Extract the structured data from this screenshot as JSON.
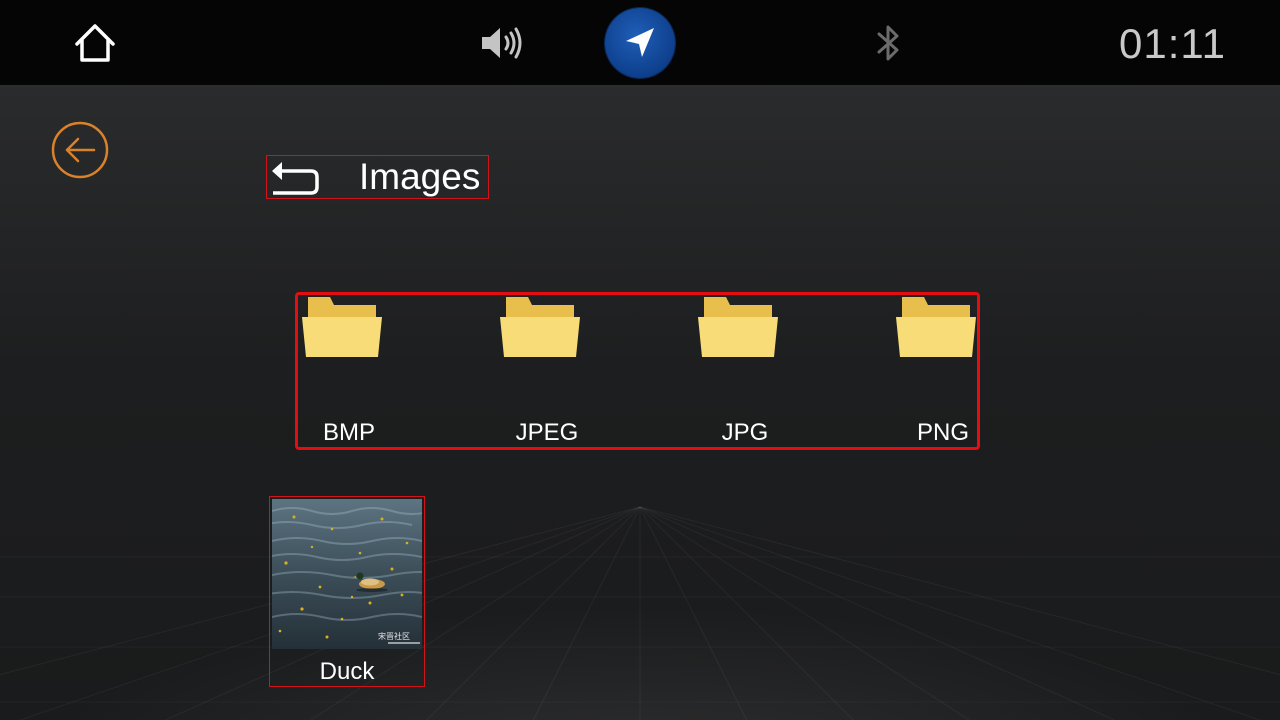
{
  "status_bar": {
    "clock": "01:11",
    "icons": [
      "home-icon",
      "volume-icon",
      "navigation-icon",
      "bluetooth-icon"
    ],
    "nav_button_color": "#0e3f8c"
  },
  "browser": {
    "title": "Images",
    "folders": [
      {
        "label": "BMP"
      },
      {
        "label": "JPEG"
      },
      {
        "label": "JPG"
      },
      {
        "label": "PNG"
      }
    ],
    "files": [
      {
        "label": "Duck",
        "watermark": "宋晋社区"
      }
    ]
  },
  "colors": {
    "back_accent": "#d9822b",
    "highlight_border": "#e30d12",
    "folder_yellow": "#f5d56a"
  }
}
